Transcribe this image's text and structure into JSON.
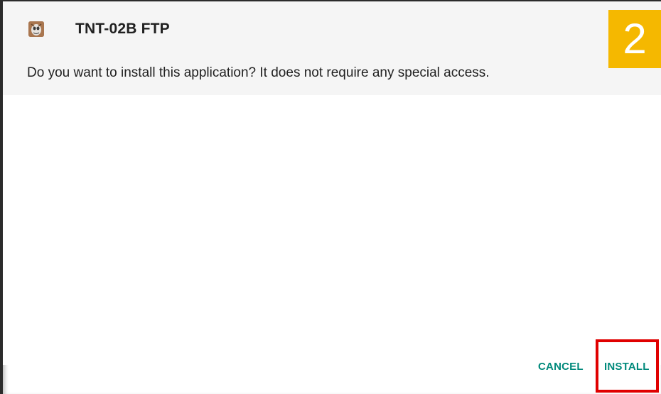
{
  "dialog": {
    "app_icon": "app-mascot-icon",
    "app_name": "TNT-02B FTP",
    "message": "Do you want to install this application? It does not require any special access."
  },
  "annotation": {
    "step_number": "2",
    "badge_color": "#f5b800",
    "highlight_color": "#e00000"
  },
  "buttons": {
    "cancel_label": "CANCEL",
    "install_label": "INSTALL",
    "accent_color": "#00897b"
  }
}
